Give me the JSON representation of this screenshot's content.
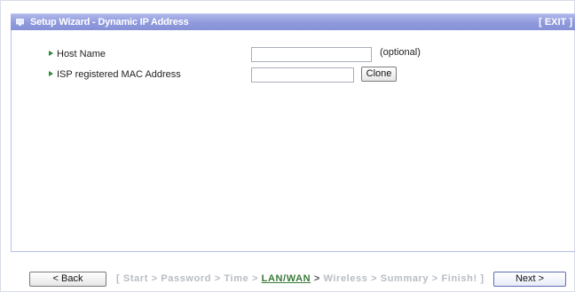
{
  "header": {
    "title": "Setup Wizard - Dynamic IP Address",
    "exit_label": "[ EXIT ]"
  },
  "form": {
    "host_name": {
      "label": "Host Name",
      "value": "",
      "hint": "(optional)"
    },
    "mac_address": {
      "label": "ISP registered MAC Address",
      "value": "",
      "clone_label": "Clone"
    }
  },
  "footer": {
    "back_label": "< Back",
    "next_label": "Next >",
    "steps_prefix": "[ Start > Password > Time > ",
    "current_step": "LAN/WAN",
    "steps_arrow": " > ",
    "steps_suffix": "Wireless > Summary > Finish! ]"
  },
  "colors": {
    "header_bg": "#8f99dc",
    "current_step": "#3a7a3a",
    "inactive_step": "#b8bcc4",
    "bullet": "#2c8a3a"
  },
  "icons": {
    "header": "monitor-icon",
    "bullet": "triangle-right-icon"
  }
}
